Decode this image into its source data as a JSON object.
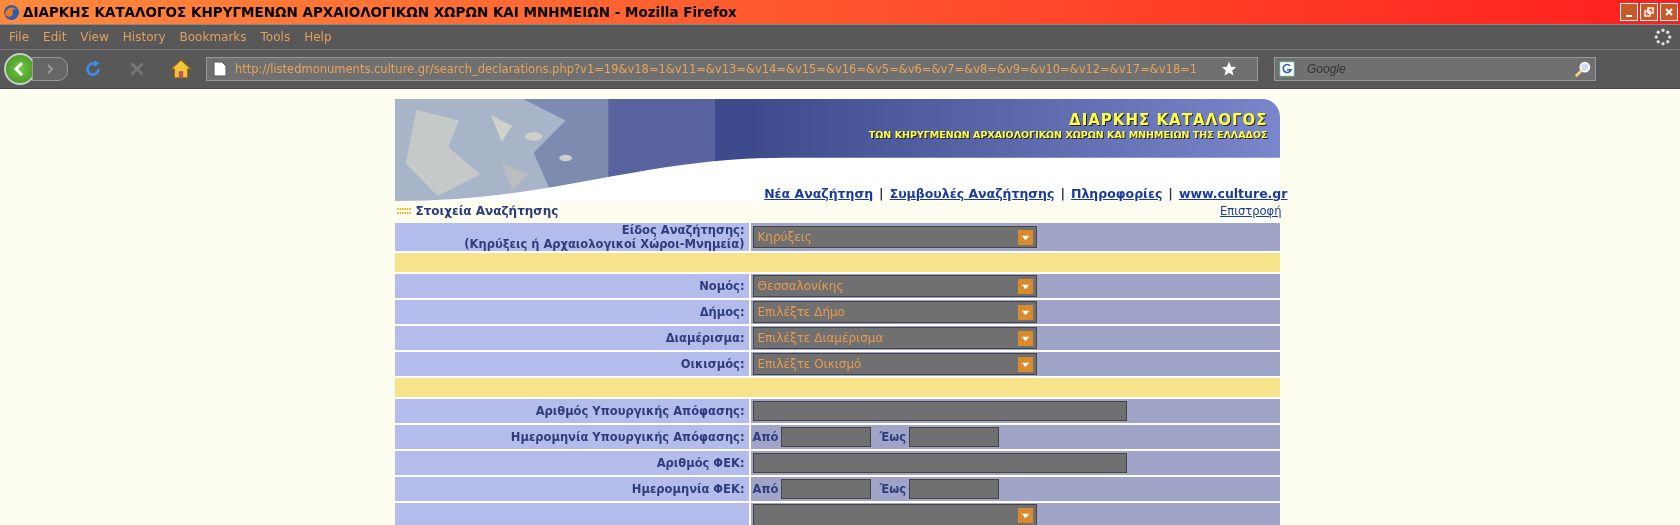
{
  "window": {
    "title": "ΔΙΑΡΚΗΣ ΚΑΤΑΛΟΓΟΣ ΚΗΡΥΓΜΕΝΩΝ ΑΡΧΑΙΟΛΟΓΙΚΩΝ ΧΩΡΩΝ ΚΑΙ ΜΝΗΜΕΙΩΝ - Mozilla Firefox"
  },
  "menu": [
    "File",
    "Edit",
    "View",
    "History",
    "Bookmarks",
    "Tools",
    "Help"
  ],
  "address": {
    "url": "http://listedmonuments.culture.gr/search_declarations.php?v1=19&v18=1&v11=&v13=&v14=&v15=&v16=&v5=&v6=&v7=&v8=&v9=&v10=&v12=&v17=&v18=1"
  },
  "search": {
    "placeholder": "Google"
  },
  "banner": {
    "title": "ΔΙΑΡΚΗΣ ΚΑΤΑΛΟΓΟΣ",
    "subtitle": "ΤΩΝ ΚΗΡΥΓΜΕΝΩΝ ΑΡΧΑΙΟΛΟΓΙΚΩΝ ΧΩΡΩΝ ΚΑΙ ΜΝΗΜΕΙΩΝ ΤΗΣ ΕΛΛΑΔΟΣ"
  },
  "links": [
    "Νέα Αναζήτηση",
    "Συμβουλές Αναζήτησης",
    "Πληροφορίες",
    "www.culture.gr"
  ],
  "link_separator": "|",
  "section": {
    "title": "Στοιχεία Αναζήτησης",
    "back": "Επιστροφή"
  },
  "rows": [
    {
      "kind": "select",
      "label": "Είδος Αναζήτησης:",
      "sublabel": "(Κηρύξεις ή Αρχαιολογικοί Χώροι-Μνημεία)",
      "value": "Κηρύξεις"
    },
    {
      "kind": "spacer"
    },
    {
      "kind": "select",
      "label": "Νομός:",
      "value": "Θεσσαλονίκης"
    },
    {
      "kind": "select",
      "label": "Δήμος:",
      "value": "Επιλέξτε Δήμο"
    },
    {
      "kind": "select",
      "label": "Διαμέρισμα:",
      "value": "Επιλέξτε Διαμέρισμα"
    },
    {
      "kind": "select",
      "label": "Οικισμός:",
      "value": "Επιλέξτε Οικισμό"
    },
    {
      "kind": "spacer"
    },
    {
      "kind": "text",
      "label": "Αριθμός Υπουργικής Απόφασης:"
    },
    {
      "kind": "daterange",
      "label": "Ημερομηνία Υπουργικής Απόφασης:",
      "from": "Από",
      "to": "Έως"
    },
    {
      "kind": "text",
      "label": "Αριθμός ΦΕΚ:"
    },
    {
      "kind": "daterange",
      "label": "Ημερομηνία ΦΕΚ:",
      "from": "Από",
      "to": "Έως"
    },
    {
      "kind": "select"
    }
  ]
}
